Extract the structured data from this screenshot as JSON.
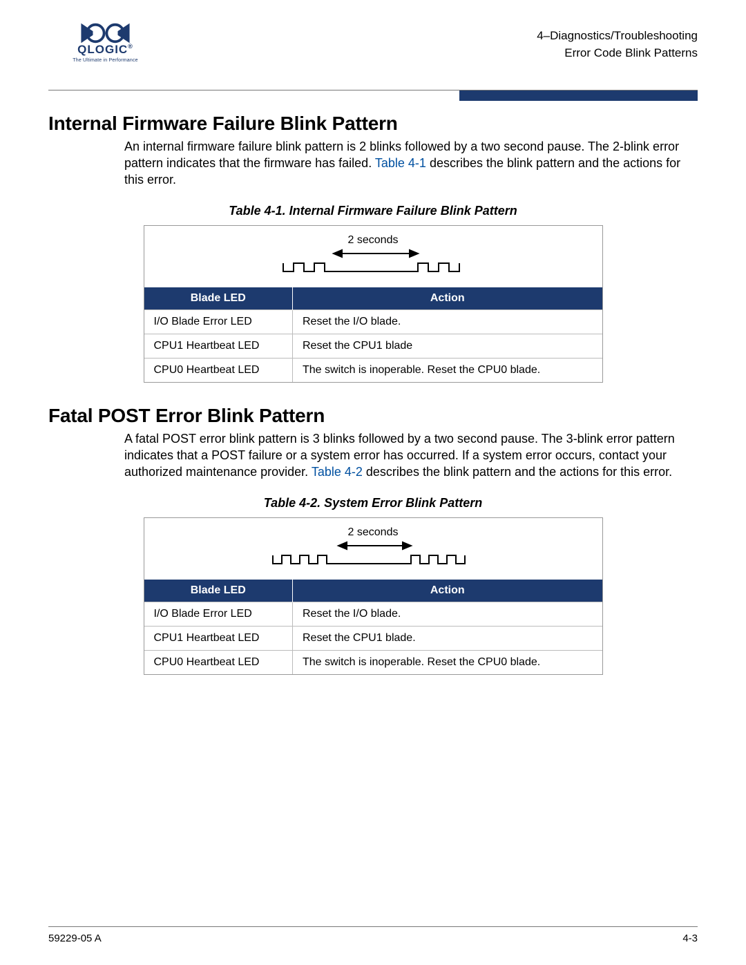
{
  "logo": {
    "brand": "QLOGIC",
    "tagline": "The Ultimate in Performance",
    "reg": "®"
  },
  "header": {
    "line1": "4–Diagnostics/Troubleshooting",
    "line2": "Error Code Blink Patterns"
  },
  "section1": {
    "title": "Internal Firmware Failure Blink Pattern",
    "para_pre": "An internal firmware failure blink pattern is 2 blinks followed by a two second pause. The 2-blink error pattern indicates that the firmware has failed. ",
    "link": "Table 4-1",
    "para_post": " describes the blink pattern and the actions for this error.",
    "caption": "Table 4-1. Internal Firmware Failure Blink Pattern",
    "diagram_label": "2 seconds",
    "table": {
      "headers": [
        "Blade LED",
        "Action"
      ],
      "rows": [
        [
          "I/O Blade Error LED",
          "Reset the I/O blade."
        ],
        [
          "CPU1 Heartbeat LED",
          "Reset the CPU1 blade"
        ],
        [
          "CPU0 Heartbeat LED",
          "The switch is inoperable. Reset the CPU0 blade."
        ]
      ]
    }
  },
  "section2": {
    "title": "Fatal POST Error Blink Pattern",
    "para_pre": "A fatal POST error blink pattern is 3 blinks followed by a two second pause. The 3-blink error pattern indicates that a POST failure or a system error has occurred. If a system error occurs, contact your authorized maintenance provider. ",
    "link": "Table 4-2",
    "para_post": " describes the blink pattern and the actions for this error.",
    "caption": "Table 4-2. System Error Blink Pattern",
    "diagram_label": "2 seconds",
    "table": {
      "headers": [
        "Blade LED",
        "Action"
      ],
      "rows": [
        [
          "I/O Blade Error LED",
          "Reset the I/O blade."
        ],
        [
          "CPU1 Heartbeat LED",
          "Reset the CPU1 blade."
        ],
        [
          "CPU0 Heartbeat LED",
          "The switch is inoperable. Reset the CPU0 blade."
        ]
      ]
    }
  },
  "footer": {
    "left": "59229-05  A",
    "right": "4-3"
  }
}
